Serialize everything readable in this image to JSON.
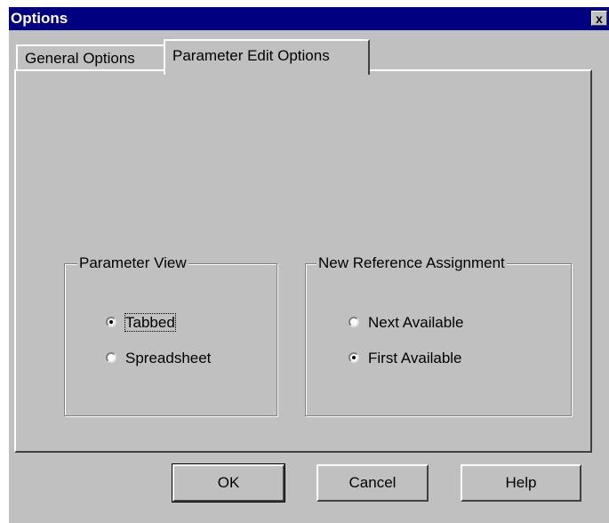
{
  "window": {
    "title": "Options",
    "close_label": "x"
  },
  "tabs": [
    {
      "label": "General Options",
      "active": false
    },
    {
      "label": "Parameter Edit Options",
      "active": true
    }
  ],
  "parameter_view": {
    "title": "Parameter View",
    "options": [
      {
        "label": "Tabbed",
        "checked": true
      },
      {
        "label": "Spreadsheet",
        "checked": false
      }
    ]
  },
  "new_reference_assignment": {
    "title": "New Reference Assignment",
    "options": [
      {
        "label": "Next Available",
        "checked": false
      },
      {
        "label": "First Available",
        "checked": true
      }
    ]
  },
  "buttons": {
    "ok": "OK",
    "cancel": "Cancel",
    "help": "Help"
  }
}
